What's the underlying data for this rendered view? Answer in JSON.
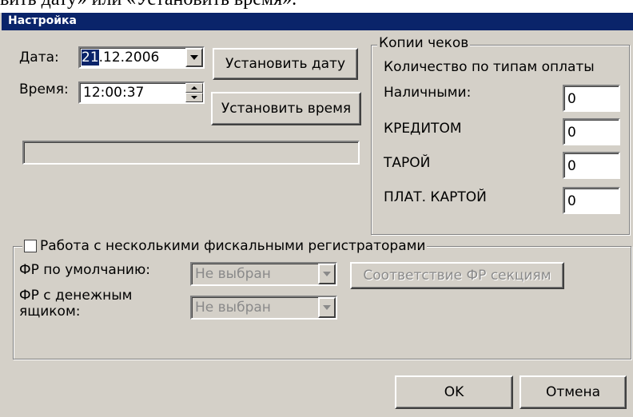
{
  "document_text": "вить дату» или «Установить время».",
  "dialog": {
    "title": "Настройка"
  },
  "date": {
    "label": "Дата:",
    "value_selected": "21",
    "value_rest": ".12.2006"
  },
  "time": {
    "label": "Время:",
    "value": "12:00:37"
  },
  "buttons": {
    "set_date": "Установить дату",
    "set_time": "Установить время",
    "ok": "OK",
    "cancel": "Отмена"
  },
  "receipt_copies": {
    "group_label": "Копии чеков",
    "subtitle": "Количество по типам оплаты",
    "rows": [
      {
        "label": "Наличными:",
        "value": "0"
      },
      {
        "label": "КРЕДИТОМ",
        "value": "0"
      },
      {
        "label": "ТАРОЙ",
        "value": "0"
      },
      {
        "label": "ПЛАТ. КАРТОЙ",
        "value": "0"
      }
    ]
  },
  "multi_fr": {
    "checkbox_label": "Работа с несколькими фискальными регистраторами",
    "checked": false,
    "default_fr_label": "ФР по умолчанию:",
    "default_fr_value": "Не выбран",
    "cash_drawer_label_line1": "ФР с денежным",
    "cash_drawer_label_line2": "ящиком:",
    "cash_drawer_value": "Не выбран",
    "sections_button": "Соответствие ФР секциям"
  },
  "colors": {
    "titlebar": "#0a246a",
    "dialog_bg": "#d4d0c8"
  }
}
